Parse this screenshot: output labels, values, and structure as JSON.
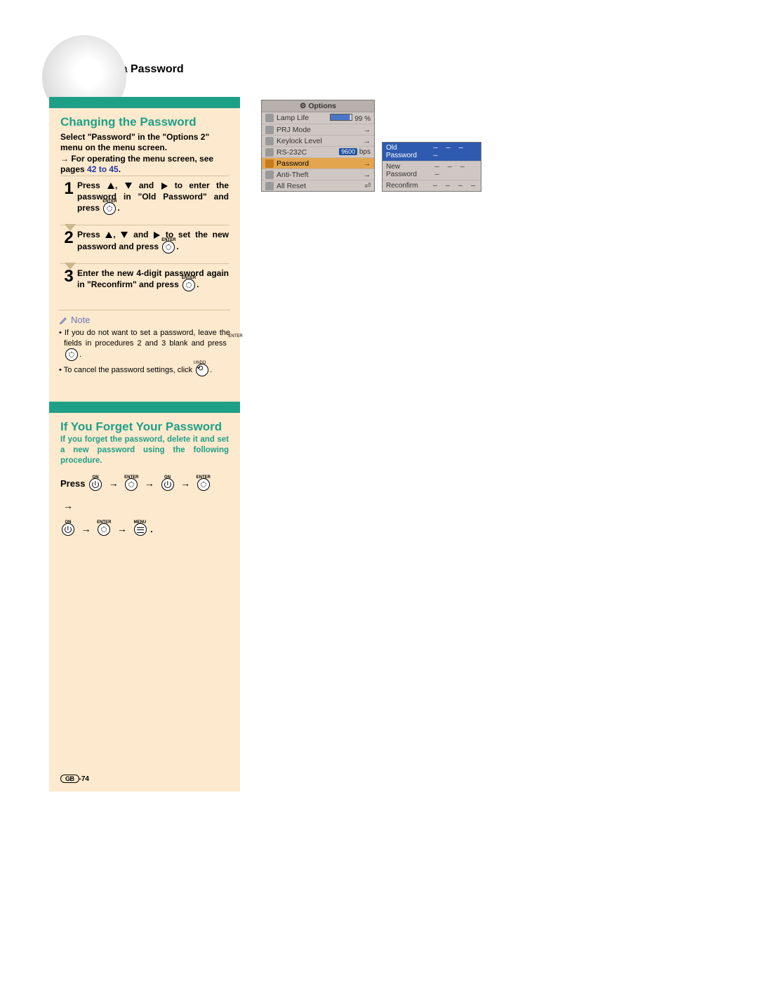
{
  "header": "Setting up a Password",
  "section1": {
    "title": "Changing the Password",
    "intro_a": "Select \"Password\" in the \"Options 2\" menu on the menu screen.",
    "intro_b_pre": "→ For operating the menu screen, see pages ",
    "intro_b_link": "42 to 45",
    "intro_b_post": "."
  },
  "steps": [
    {
      "num": "1",
      "pre": "Press ",
      "mid": " to enter the password in \"Old Password\" and press ",
      "post": "."
    },
    {
      "num": "2",
      "pre": "Press ",
      "mid": " to set the new password and press ",
      "post": "."
    },
    {
      "num": "3",
      "text_a": "Enter the new 4-digit password again in \"Reconfirm\" and press ",
      "post": "."
    }
  ],
  "note": {
    "label": "Note",
    "li1_a": "If you do not want to set a password, leave the fields in procedures 2 and 3 blank and press ",
    "li1_b": ".",
    "li2_a": "To cancel the password settings, click ",
    "li2_b": "."
  },
  "section2": {
    "title": "If You Forget Your Password",
    "intro": "If you forget the password, delete it and set a new password using the following procedure.",
    "press": "Press"
  },
  "button_labels": {
    "on": "ON",
    "enter": "ENTER",
    "menu": "MENU",
    "undo": "UNDO"
  },
  "osd": {
    "title": "Options",
    "rows": [
      {
        "label": "Lamp Life",
        "value": "99",
        "unit": "%"
      },
      {
        "label": "PRJ Mode"
      },
      {
        "label": "Keylock Level"
      },
      {
        "label": "RS-232C",
        "badge": "9600",
        "unit": "bps"
      },
      {
        "label": "Password",
        "selected": true
      },
      {
        "label": "Anti-Theft"
      },
      {
        "label": "All Reset"
      }
    ]
  },
  "osd2": {
    "rows": [
      {
        "label": "Old Password",
        "value": "– – – –",
        "selected": true
      },
      {
        "label": "New Password",
        "value": "– – – –"
      },
      {
        "label": "Reconfirm",
        "value": "– – – –"
      }
    ]
  },
  "footer": {
    "code": "GB",
    "page": "-74"
  }
}
